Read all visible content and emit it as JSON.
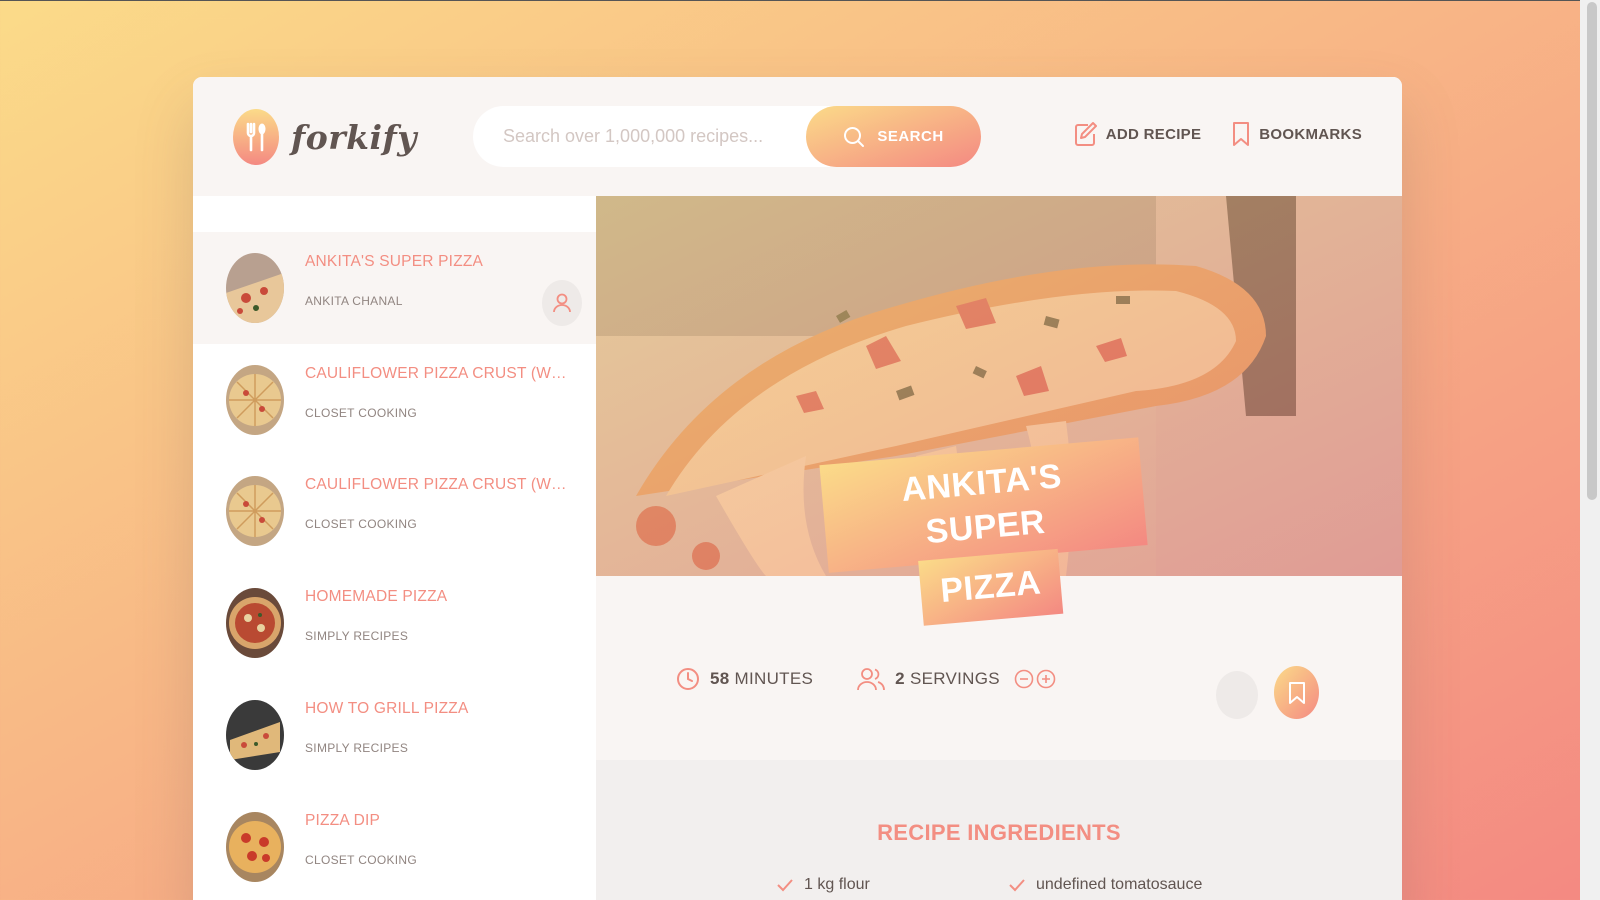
{
  "header": {
    "logo_text": "forkify",
    "search_placeholder": "Search over 1,000,000 recipes...",
    "search_button": "SEARCH",
    "add_recipe": "ADD RECIPE",
    "bookmarks": "BOOKMARKS"
  },
  "results": [
    {
      "title": "ANKITA'S SUPER PIZZA",
      "publisher": "ANKITA CHANAL",
      "user_generated": true,
      "active": true
    },
    {
      "title": "CAULIFLOWER PIZZA CRUST (WIT...",
      "publisher": "CLOSET COOKING"
    },
    {
      "title": "CAULIFLOWER PIZZA CRUST (WIT...",
      "publisher": "CLOSET COOKING"
    },
    {
      "title": "HOMEMADE PIZZA",
      "publisher": "SIMPLY RECIPES"
    },
    {
      "title": "HOW TO GRILL PIZZA",
      "publisher": "SIMPLY RECIPES"
    },
    {
      "title": "PIZZA DIP",
      "publisher": "CLOSET COOKING"
    }
  ],
  "recipe": {
    "title_line1": "ANKITA'S SUPER",
    "title_line2": "PIZZA",
    "cooking_time": "58",
    "time_unit": "MINUTES",
    "servings": "2",
    "servings_unit": "SERVINGS",
    "ingredients_heading": "RECIPE INGREDIENTS",
    "ingredients": [
      "1 kg flour",
      "undefined tomatosauce"
    ]
  },
  "icons": {
    "logo": "fork-spoon-icon",
    "search": "search-icon",
    "add_recipe": "edit-icon",
    "bookmarks": "bookmark-icon",
    "time": "clock-icon",
    "servings": "users-icon",
    "decrease": "minus-circle-icon",
    "increase": "plus-circle-icon",
    "user": "user-icon",
    "check": "check-icon"
  },
  "colors": {
    "gradient_start": "#fbdb89",
    "gradient_end": "#f48982",
    "accent_text": "#f38e82",
    "dark_text": "#615551",
    "panel_bg": "#f9f5f3"
  }
}
